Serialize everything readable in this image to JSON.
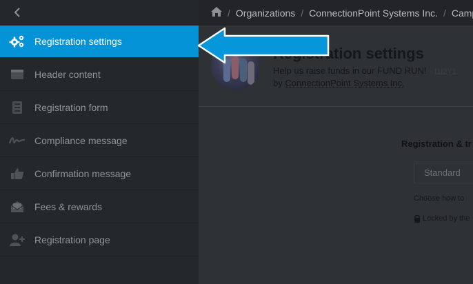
{
  "sidebar": {
    "items": [
      {
        "label": "Registration settings",
        "icon": "gear-icon",
        "active": true
      },
      {
        "label": "Header content",
        "icon": "browser-window-icon"
      },
      {
        "label": "Registration form",
        "icon": "form-list-icon"
      },
      {
        "label": "Compliance message",
        "icon": "signature-icon"
      },
      {
        "label": "Confirmation message",
        "icon": "thumbs-up-icon"
      },
      {
        "label": "Fees & rewards",
        "icon": "envelope-open-icon"
      },
      {
        "label": "Registration page",
        "icon": "user-plus-icon"
      }
    ]
  },
  "breadcrumb": {
    "items": [
      "Organizations",
      "ConnectionPoint Systems Inc.",
      "Camp"
    ]
  },
  "header": {
    "title": "Registration settings",
    "subtitle": "Help us raise funds in our FUND RUN!",
    "code": "f1t2Y1",
    "by_prefix": "by",
    "organization": "ConnectionPoint Systems Inc."
  },
  "content": {
    "section_label": "Registration & tr",
    "select_value": "Standard",
    "help_text": "Choose how to",
    "locked_text": "Locked by the"
  },
  "colors": {
    "accent": "#0593d8",
    "sidebar_bg": "#25282b",
    "callout_arrow": "#0597d9"
  }
}
